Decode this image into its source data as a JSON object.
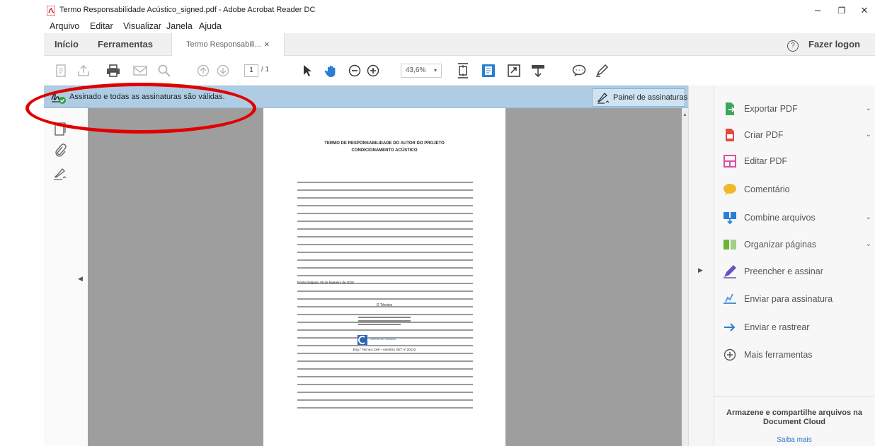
{
  "window": {
    "title": "Termo Responsabilidade Acústico_signed.pdf - Adobe Acrobat Reader DC",
    "controls": {
      "minimize": "–",
      "restore": "❐",
      "close": "✕"
    }
  },
  "menu": [
    "Arquivo",
    "Editar",
    "Visualizar",
    "Janela",
    "Ajuda"
  ],
  "tabs": {
    "home": "Início",
    "tools": "Ferramentas",
    "document": "Termo Responsabili...",
    "document_close": "×",
    "help_icon": "?",
    "login": "Fazer logon"
  },
  "toolbar": {
    "page_current": "1",
    "page_total": "/ 1",
    "zoom": "43,6%"
  },
  "signature_bar": {
    "message": "Assinado e todas as assinaturas são válidas.",
    "panel_button": "Painel de assinaturas",
    "annotation_color": "#e00000",
    "bar_color": "#aecde4"
  },
  "document": {
    "title_line1": "TERMO DE RESPONSABILIDADE DO AUTOR DO PROJETO",
    "title_line2": "CONDICIONAMENTO ACÚSTICO",
    "place_date": "Ponta Delgada, 05 de fevereiro de 2018",
    "signer_role": "O Técnico",
    "card_label": "CARTÃO DE CIDADÃO",
    "footer": "Eng.º Técnico Civil – membro OET nº 20142"
  },
  "tools_panel": {
    "items": [
      {
        "label": "Exportar PDF",
        "icon": "export-pdf-icon",
        "color": "#3aa85a",
        "has_dropdown": true
      },
      {
        "label": "Criar PDF",
        "icon": "create-pdf-icon",
        "color": "#e04a3f",
        "has_dropdown": true
      },
      {
        "label": "Editar PDF",
        "icon": "edit-pdf-icon",
        "color": "#d94fa0",
        "has_dropdown": false
      },
      {
        "label": "Comentário",
        "icon": "comment-icon",
        "color": "#f2b82a",
        "has_dropdown": false
      },
      {
        "label": "Combine arquivos",
        "icon": "combine-files-icon",
        "color": "#2a7fd4",
        "has_dropdown": true
      },
      {
        "label": "Organizar páginas",
        "icon": "organize-pages-icon",
        "color": "#6bb33a",
        "has_dropdown": true
      },
      {
        "label": "Preencher e assinar",
        "icon": "fill-sign-icon",
        "color": "#6c4fc2",
        "has_dropdown": false
      },
      {
        "label": "Enviar para assinatura",
        "icon": "send-for-signature-icon",
        "color": "#4a90d9",
        "has_dropdown": false
      },
      {
        "label": "Enviar e rastrear",
        "icon": "send-track-icon",
        "color": "#2a7fd4",
        "has_dropdown": false
      },
      {
        "label": "Mais ferramentas",
        "icon": "more-tools-icon",
        "color": "#555555",
        "has_dropdown": false
      }
    ],
    "promo_title": "Armazene e compartilhe arquivos na Document Cloud",
    "promo_link": "Saiba mais"
  }
}
